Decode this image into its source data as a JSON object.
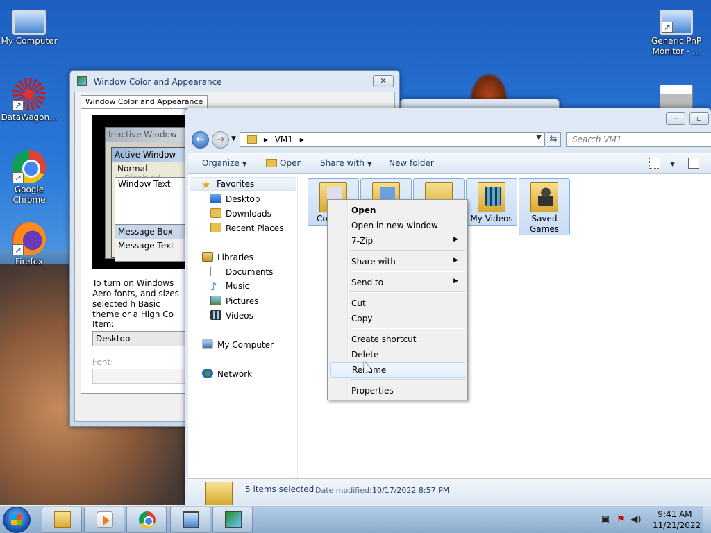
{
  "desktop": {
    "icons": [
      {
        "label": "My Computer",
        "icon": "computer-icon"
      },
      {
        "label": "DataWagon...",
        "icon": "datawagon-icon"
      },
      {
        "label": "Google Chrome",
        "icon": "chrome-icon"
      },
      {
        "label": "Firefox",
        "icon": "firefox-icon"
      },
      {
        "label": "Generic PnP Monitor - ...",
        "icon": "monitor-icon"
      },
      {
        "label": "",
        "icon": "printer-icon"
      }
    ]
  },
  "wca_dialog": {
    "title": "Window Color and Appearance",
    "close_label": "✕",
    "tab_label": "Window Color and Appearance",
    "preview": {
      "inactive_title": "Inactive Window",
      "active_title": "Active Window",
      "menu_normal": "Normal",
      "menu_disabled": "Disabled",
      "window_text": "Window Text",
      "message_box_title": "Message Box",
      "message_text": "Message Text"
    },
    "description": "To turn on Windows Aero fonts, and sizes selected h Basic theme or a High Co",
    "item_label": "Item:",
    "item_value": "Desktop",
    "font_label": "Font:",
    "font_value": ""
  },
  "explorer": {
    "address": {
      "path": "VM1",
      "separator": "▸"
    },
    "search_placeholder": "Search VM1",
    "toolbar": {
      "organize": "Organize",
      "open": "Open",
      "share_with": "Share with",
      "new_folder": "New folder"
    },
    "nav": {
      "favorites": "Favorites",
      "favorites_items": [
        "Desktop",
        "Downloads",
        "Recent Places"
      ],
      "libraries": "Libraries",
      "libraries_items": [
        "Documents",
        "Music",
        "Pictures",
        "Videos"
      ],
      "my_computer": "My Computer",
      "network": "Network"
    },
    "items": [
      {
        "label": "Co",
        "selected": true
      },
      {
        "label": "",
        "selected": true
      },
      {
        "label": "",
        "selected": true
      },
      {
        "label": "My Videos",
        "selected": true
      },
      {
        "label": "Saved Games",
        "selected": true
      }
    ],
    "status": {
      "count": "5 items selected",
      "date_label": "Date modified:",
      "date_value": "10/17/2022 8:57 PM"
    }
  },
  "context_menu": {
    "items": [
      {
        "label": "Open",
        "bold": true
      },
      {
        "label": "Open in new window"
      },
      {
        "label": "7-Zip",
        "submenu": true
      },
      {
        "label": "Share with",
        "submenu": true
      },
      {
        "label": "Send to",
        "submenu": true
      },
      {
        "label": "Cut"
      },
      {
        "label": "Copy"
      },
      {
        "label": "Create shortcut"
      },
      {
        "label": "Delete"
      },
      {
        "label": "Rename",
        "hover": true
      },
      {
        "label": "Properties"
      }
    ],
    "submenu_arrow": "▶"
  },
  "taskbar": {
    "buttons": [
      "Windows Explorer",
      "Windows Media Player",
      "Google Chrome",
      "Display Settings",
      "Window Color and Appearance"
    ],
    "clock_time": "9:41 AM",
    "clock_date": "11/21/2022"
  }
}
